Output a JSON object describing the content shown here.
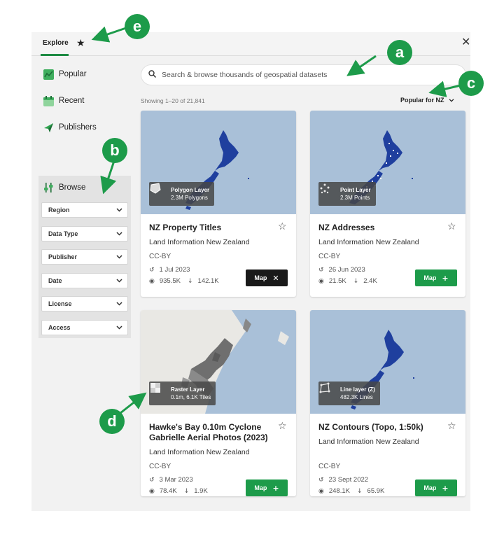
{
  "tabs": {
    "explore": "Explore",
    "favorites_icon": "star-icon"
  },
  "sidebar": {
    "items": [
      {
        "label": "Popular",
        "icon": "popular-icon"
      },
      {
        "label": "Recent",
        "icon": "calendar-icon"
      },
      {
        "label": "Publishers",
        "icon": "publisher-icon"
      }
    ],
    "browse": "Browse",
    "filters": [
      "Region",
      "Data Type",
      "Publisher",
      "Date",
      "License",
      "Access"
    ]
  },
  "search": {
    "placeholder": "Search & browse thousands of geospatial datasets"
  },
  "results": {
    "count": "Showing 1–20 of 21,841",
    "sort": "Popular for NZ"
  },
  "cards": [
    {
      "title": "NZ Property Titles",
      "publisher": "Land Information New Zealand",
      "license": "CC-BY",
      "date": "1 Jul 2023",
      "views": "935.5K",
      "downloads": "142.1K",
      "layer_type": "Polygon Layer",
      "layer_stats": "2.3M Polygons",
      "button": "Map",
      "button_state": "active"
    },
    {
      "title": "NZ Addresses",
      "publisher": "Land Information New Zealand",
      "license": "CC-BY",
      "date": "26 Jun 2023",
      "views": "21.5K",
      "downloads": "2.4K",
      "layer_type": "Point Layer",
      "layer_stats": "2.3M Points",
      "button": "Map",
      "button_state": "add"
    },
    {
      "title": "Hawke's Bay 0.10m Cyclone Gabrielle Aerial Photos (2023)",
      "publisher": "Land Information New Zealand",
      "license": "CC-BY",
      "date": "3 Mar 2023",
      "views": "78.4K",
      "downloads": "1.9K",
      "layer_type": "Raster Layer",
      "layer_stats": "0.1m, 6.1K Tiles",
      "button": "Map",
      "button_state": "add"
    },
    {
      "title": "NZ Contours (Topo, 1:50k)",
      "publisher": "Land Information New Zealand",
      "license": "CC-BY",
      "date": "23 Sept 2022",
      "views": "248.1K",
      "downloads": "65.9K",
      "layer_type": "Line layer (Z)",
      "layer_stats": "482.3K Lines",
      "button": "Map",
      "button_state": "add"
    }
  ],
  "callouts": [
    "a",
    "b",
    "c",
    "d",
    "e"
  ],
  "colors": {
    "accent": "#1d9b4a",
    "map_water": "#a9c0d8",
    "nz_land": "#1f3f9e"
  }
}
